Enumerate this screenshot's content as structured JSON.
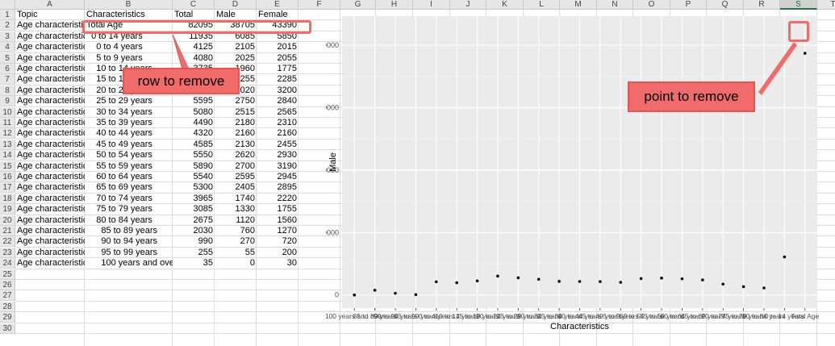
{
  "sheet": {
    "columns": [
      "A",
      "B",
      "C",
      "D",
      "E",
      "F",
      "G",
      "H",
      "I",
      "J",
      "K",
      "L",
      "M",
      "N",
      "O",
      "P",
      "Q",
      "R",
      "S",
      "T"
    ],
    "selected_column": "S",
    "rows": [
      "1",
      "2",
      "3",
      "4",
      "5",
      "6",
      "7",
      "8",
      "9",
      "10",
      "11",
      "12",
      "13",
      "14",
      "15",
      "16",
      "17",
      "18",
      "19",
      "20",
      "21",
      "22",
      "23",
      "24",
      "25",
      "26",
      "27",
      "28",
      "29",
      "30"
    ],
    "header_row": [
      "Topic",
      "Characteristics",
      "Total",
      "Male",
      "Female"
    ],
    "data_rows": [
      [
        "Age characteristics",
        "Total Age",
        "82095",
        "38705",
        "43390"
      ],
      [
        "Age characteristics",
        "  0 to 14 years",
        "11935",
        "6085",
        "5850"
      ],
      [
        "Age characteristics",
        "    0 to 4 years",
        "4125",
        "2105",
        "2015"
      ],
      [
        "Age characteristics",
        "    5 to 9 years",
        "4080",
        "2025",
        "2055"
      ],
      [
        "Age characteristics",
        "    10 to 14 years",
        "3735",
        "1960",
        "1775"
      ],
      [
        "Age characteristics",
        "    15 to 19 years",
        "4540",
        "2255",
        "2285"
      ],
      [
        "Age characteristics",
        "    20 to 24 years",
        "6220",
        "3020",
        "3200"
      ],
      [
        "Age characteristics",
        "    25 to 29 years",
        "5595",
        "2750",
        "2840"
      ],
      [
        "Age characteristics",
        "    30 to 34 years",
        "5080",
        "2515",
        "2565"
      ],
      [
        "Age characteristics",
        "    35 to 39 years",
        "4490",
        "2180",
        "2310"
      ],
      [
        "Age characteristics",
        "    40 to 44 years",
        "4320",
        "2160",
        "2160"
      ],
      [
        "Age characteristics",
        "    45 to 49 years",
        "4585",
        "2130",
        "2455"
      ],
      [
        "Age characteristics",
        "    50 to 54 years",
        "5550",
        "2620",
        "2930"
      ],
      [
        "Age characteristics",
        "    55 to 59 years",
        "5890",
        "2700",
        "3190"
      ],
      [
        "Age characteristics",
        "    60 to 64 years",
        "5540",
        "2595",
        "2945"
      ],
      [
        "Age characteristics",
        "    65 to 69 years",
        "5300",
        "2405",
        "2895"
      ],
      [
        "Age characteristics",
        "    70 to 74 years",
        "3965",
        "1740",
        "2220"
      ],
      [
        "Age characteristics",
        "    75 to 79 years",
        "3085",
        "1330",
        "1755"
      ],
      [
        "Age characteristics",
        "    80 to 84 years",
        "2675",
        "1120",
        "1560"
      ],
      [
        "Age characteristics",
        "      85 to 89 years",
        "2030",
        "760",
        "1270"
      ],
      [
        "Age characteristics",
        "      90 to 94 years",
        "990",
        "270",
        "720"
      ],
      [
        "Age characteristics",
        "      95 to 99 years",
        "255",
        "55",
        "200"
      ],
      [
        "Age characteristics",
        "      100 years and over",
        "35",
        "0",
        "30"
      ]
    ]
  },
  "annotations": {
    "row_callout": "row to remove",
    "point_callout": "point to remove",
    "accent_color": "#f26b6b"
  },
  "chart_data": {
    "type": "scatter",
    "xlabel": "Characteristics",
    "ylabel": "Male",
    "ylim": [
      0,
      40000
    ],
    "y_ticks": [
      "0",
      "10000",
      "20000",
      "30000",
      "40000"
    ],
    "categories": [
      "100 years and over",
      "85 to 89 years",
      "90 to 94 years",
      "95 to 99 years",
      "0 to 4 years",
      "10 to 14 years",
      "15 to 19 years",
      "20 to 24 years",
      "25 to 29 years",
      "30 to 34 years",
      "35 to 39 years",
      "40 to 44 years",
      "45 to 49 years",
      "5 to 9 years",
      "50 to 54 years",
      "55 to 59 years",
      "60 to 64 years",
      "65 to 69 years",
      "70 to 74 years",
      "75 to 79 years",
      "80 to 84 years",
      "0 to 14 years",
      "Total Age"
    ],
    "values": [
      0,
      760,
      270,
      55,
      2105,
      1960,
      2255,
      3020,
      2750,
      2515,
      2180,
      2160,
      2130,
      2025,
      2620,
      2700,
      2595,
      2405,
      1740,
      1330,
      1120,
      6085,
      38705
    ],
    "background": "#ebebeb",
    "point_color": "#000000",
    "grid": true
  }
}
